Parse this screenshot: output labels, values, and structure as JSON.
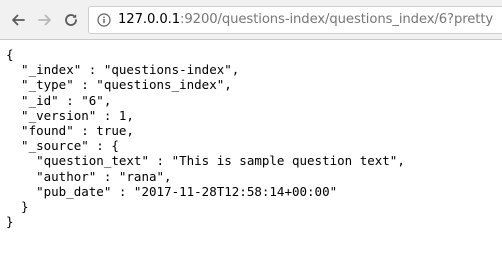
{
  "browser": {
    "url_host": "127.0.0.1",
    "url_rest": ":9200/questions-index/questions_index/6?pretty",
    "icons": {
      "back": "arrow-left-icon",
      "forward": "arrow-right-icon",
      "reload": "reload-icon",
      "site_info": "info-icon"
    }
  },
  "document": {
    "lines": [
      "{",
      "  \"_index\" : \"questions-index\",",
      "  \"_type\" : \"questions_index\",",
      "  \"_id\" : \"6\",",
      "  \"_version\" : 1,",
      "  \"found\" : true,",
      "  \"_source\" : {",
      "    \"question_text\" : \"This is sample question text\",",
      "    \"author\" : \"rana\",",
      "    \"pub_date\" : \"2017-11-28T12:58:14+00:00\"",
      "  }",
      "}"
    ]
  }
}
